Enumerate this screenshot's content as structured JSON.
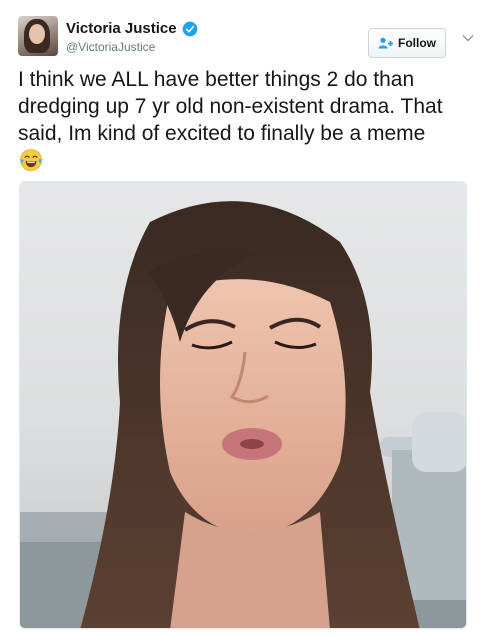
{
  "tweet": {
    "author_name": "Victoria Justice",
    "author_handle": "@VictoriaJustice",
    "text": "I think we ALL have better things 2 do than dredging up 7 yr old non-existent drama. That said, Im kind of excited to finally be a meme",
    "emoji": "face-with-tears-of-joy"
  },
  "header": {
    "follow_label": "Follow"
  },
  "colors": {
    "verified_blue": "#1da1f2",
    "text": "#14171a",
    "secondary_text": "#657786"
  },
  "icons": {
    "verified": "verified-badge-icon",
    "follow": "add-user-icon",
    "menu": "chevron-down-icon"
  }
}
